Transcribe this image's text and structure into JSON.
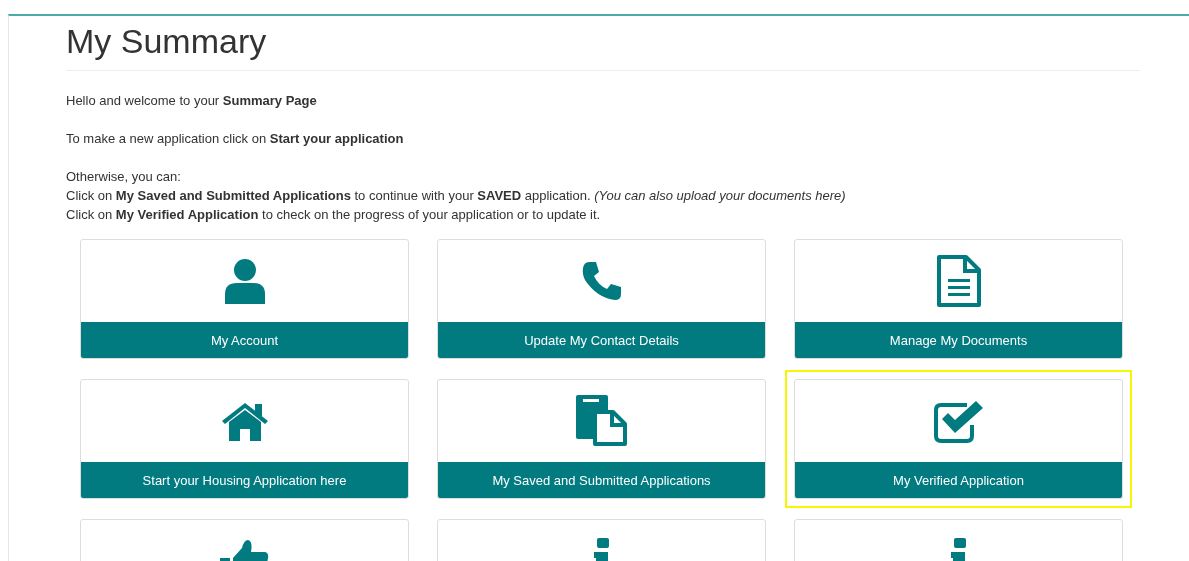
{
  "title": "My Summary",
  "paragraphs": [
    {
      "lines": [
        "Hello and welcome to your **Summary Page**"
      ]
    },
    {
      "lines": [
        "To make a new application click on **Start your application**"
      ]
    },
    {
      "lines": [
        "Otherwise, you can:",
        "Click on **My Saved and Submitted Applications** to continue with your **SAVED** application. *(You can also upload your documents here)*",
        "Click on **My Verified Application** to check on the progress of your application or to update it."
      ]
    }
  ],
  "tiles": [
    {
      "kind": "person",
      "label": "My Account",
      "highlighted": false
    },
    {
      "kind": "phone",
      "label": "Update My Contact Details",
      "highlighted": false
    },
    {
      "kind": "document",
      "label": "Manage My Documents",
      "highlighted": false
    },
    {
      "kind": "house",
      "label": "Start your Housing Application here",
      "highlighted": false
    },
    {
      "kind": "copy",
      "label": "My Saved and Submitted Applications",
      "highlighted": false
    },
    {
      "kind": "checkbox",
      "label": "My Verified Application",
      "highlighted": true
    },
    {
      "kind": "thumbs-up",
      "highlighted": false
    },
    {
      "kind": "info",
      "highlighted": false
    },
    {
      "kind": "info",
      "highlighted": false
    }
  ]
}
